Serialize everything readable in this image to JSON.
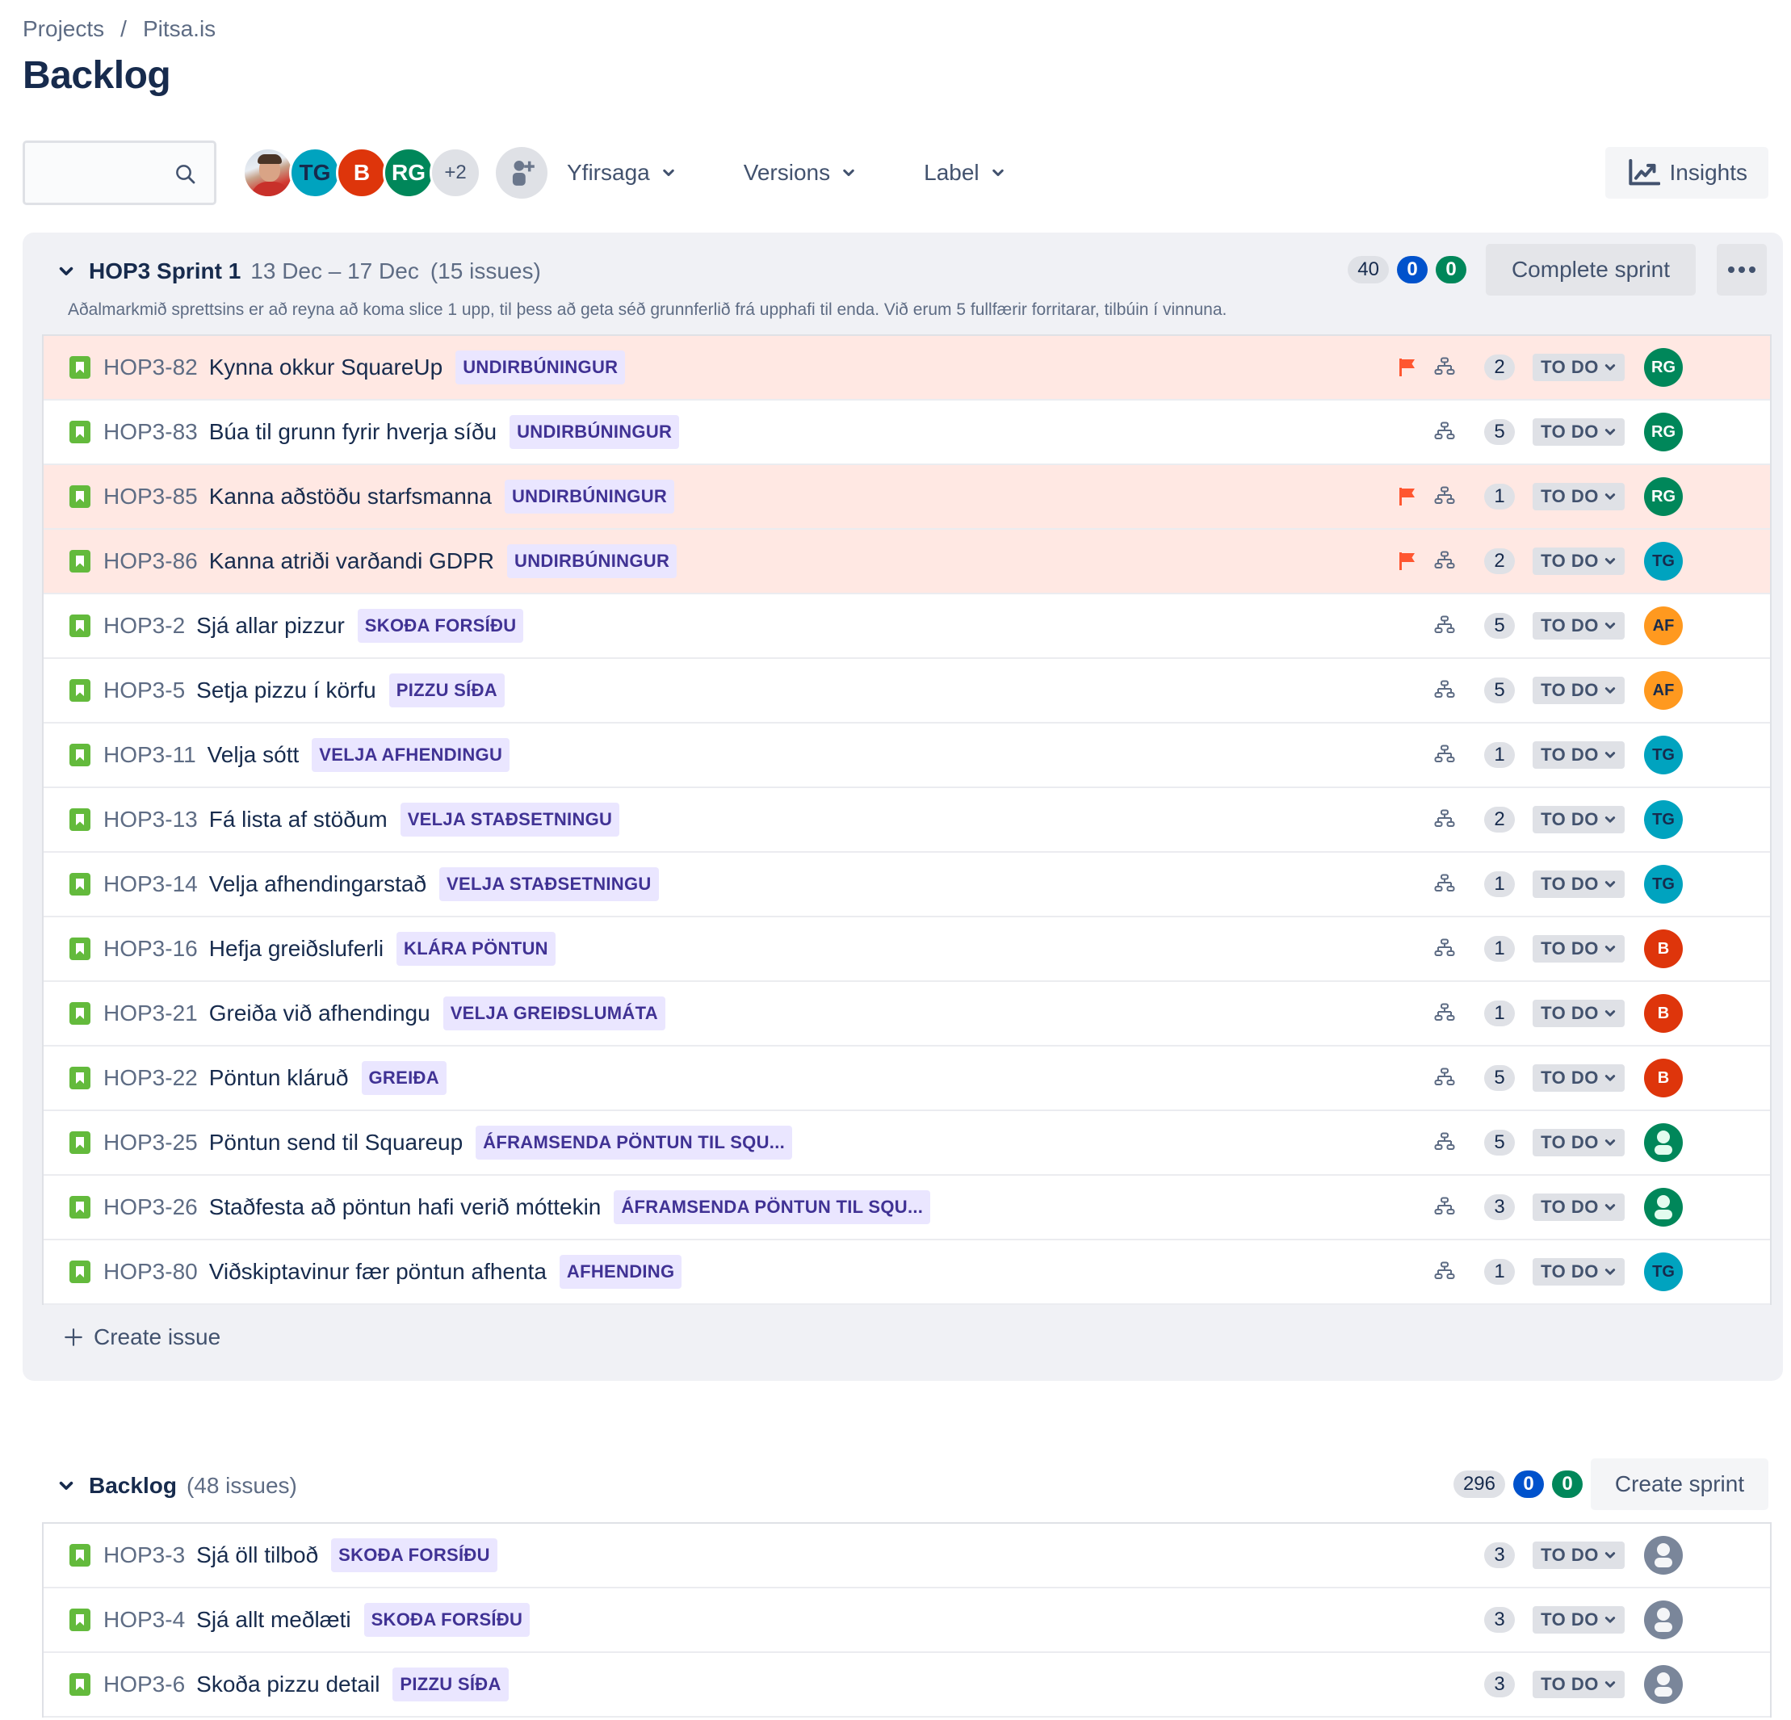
{
  "breadcrumb": {
    "items": [
      "Projects",
      "Pitsa.is"
    ],
    "separator": "/"
  },
  "page_title": "Backlog",
  "toolbar": {
    "search": {
      "value": "",
      "placeholder": ""
    },
    "avatars": [
      {
        "type": "photo",
        "initials": ""
      },
      {
        "initials": "TG",
        "color": "#00a3bf",
        "text_color": "#172b4d"
      },
      {
        "initials": "B",
        "color": "#de350b",
        "text_color": "#ffffff"
      },
      {
        "initials": "RG",
        "color": "#00875a",
        "text_color": "#ffffff"
      },
      {
        "initials": "+2",
        "color": "#dfe1e6",
        "text_color": "#42526e"
      }
    ],
    "filters": [
      "Yfirsaga",
      "Versions",
      "Label"
    ],
    "insights_label": "Insights"
  },
  "sprint": {
    "name": "HOP3 Sprint 1",
    "dates": "13 Dec – 17 Dec",
    "issue_count": "(15 issues)",
    "goal": "Aðalmarkmið sprettsins er að reyna að koma slice 1 upp, til þess að geta séð grunnferlið frá upphafi til enda. Við erum 5 fullfærir forritarar, tilbúin í vinnuna.",
    "points_total": "40",
    "points_in_progress": "0",
    "points_done": "0",
    "complete_label": "Complete sprint",
    "more_label": "•••",
    "create_issue_label": "Create issue",
    "issues": [
      {
        "key": "HOP3-82",
        "summary": "Kynna okkur SquareUp",
        "epic": "UNDIRBÚNINGUR",
        "flagged": true,
        "points": "2",
        "status": "TO DO",
        "assignee": "RG",
        "assignee_color": "#00875a",
        "assignee_text": "#ffffff"
      },
      {
        "key": "HOP3-83",
        "summary": "Búa til grunn fyrir hverja síðu",
        "epic": "UNDIRBÚNINGUR",
        "flagged": false,
        "points": "5",
        "status": "TO DO",
        "assignee": "RG",
        "assignee_color": "#00875a",
        "assignee_text": "#ffffff"
      },
      {
        "key": "HOP3-85",
        "summary": "Kanna aðstöðu starfsmanna",
        "epic": "UNDIRBÚNINGUR",
        "flagged": true,
        "points": "1",
        "status": "TO DO",
        "assignee": "RG",
        "assignee_color": "#00875a",
        "assignee_text": "#ffffff"
      },
      {
        "key": "HOP3-86",
        "summary": "Kanna atriði varðandi GDPR",
        "epic": "UNDIRBÚNINGUR",
        "flagged": true,
        "points": "2",
        "status": "TO DO",
        "assignee": "TG",
        "assignee_color": "#00a3bf",
        "assignee_text": "#172b4d"
      },
      {
        "key": "HOP3-2",
        "summary": "Sjá allar pizzur",
        "epic": "SKOÐA FORSÍÐU",
        "flagged": false,
        "points": "5",
        "status": "TO DO",
        "assignee": "AF",
        "assignee_color": "#ff991f",
        "assignee_text": "#172b4d"
      },
      {
        "key": "HOP3-5",
        "summary": "Setja pizzu í körfu",
        "epic": "PIZZU SÍÐA",
        "flagged": false,
        "points": "5",
        "status": "TO DO",
        "assignee": "AF",
        "assignee_color": "#ff991f",
        "assignee_text": "#172b4d"
      },
      {
        "key": "HOP3-11",
        "summary": "Velja sótt",
        "epic": "VELJA AFHENDINGU",
        "flagged": false,
        "points": "1",
        "status": "TO DO",
        "assignee": "TG",
        "assignee_color": "#00a3bf",
        "assignee_text": "#172b4d"
      },
      {
        "key": "HOP3-13",
        "summary": "Fá lista af stöðum",
        "epic": "VELJA STAÐSETNINGU",
        "flagged": false,
        "points": "2",
        "status": "TO DO",
        "assignee": "TG",
        "assignee_color": "#00a3bf",
        "assignee_text": "#172b4d"
      },
      {
        "key": "HOP3-14",
        "summary": "Velja afhendingarstað",
        "epic": "VELJA STAÐSETNINGU",
        "flagged": false,
        "points": "1",
        "status": "TO DO",
        "assignee": "TG",
        "assignee_color": "#00a3bf",
        "assignee_text": "#172b4d"
      },
      {
        "key": "HOP3-16",
        "summary": "Hefja greiðsluferli",
        "epic": "KLÁRA PÖNTUN",
        "flagged": false,
        "points": "1",
        "status": "TO DO",
        "assignee": "B",
        "assignee_color": "#de350b",
        "assignee_text": "#ffffff"
      },
      {
        "key": "HOP3-21",
        "summary": "Greiða við afhendingu",
        "epic": "VELJA GREIÐSLUMÁTA",
        "flagged": false,
        "points": "1",
        "status": "TO DO",
        "assignee": "B",
        "assignee_color": "#de350b",
        "assignee_text": "#ffffff"
      },
      {
        "key": "HOP3-22",
        "summary": "Pöntun kláruð",
        "epic": "GREIÐA",
        "flagged": false,
        "points": "5",
        "status": "TO DO",
        "assignee": "B",
        "assignee_color": "#de350b",
        "assignee_text": "#ffffff"
      },
      {
        "key": "HOP3-25",
        "summary": "Pöntun send til Squareup",
        "epic": "ÁFRAMSENDA PÖNTUN TIL SQU...",
        "flagged": false,
        "points": "5",
        "status": "TO DO",
        "assignee": "",
        "assignee_icon": "person-icon",
        "assignee_color": "#00875a",
        "assignee_text": "#ffffff"
      },
      {
        "key": "HOP3-26",
        "summary": "Staðfesta að pöntun hafi verið móttekin",
        "epic": "ÁFRAMSENDA PÖNTUN TIL SQU...",
        "flagged": false,
        "points": "3",
        "status": "TO DO",
        "assignee": "",
        "assignee_icon": "person-icon",
        "assignee_color": "#00875a",
        "assignee_text": "#ffffff"
      },
      {
        "key": "HOP3-80",
        "summary": "Viðskiptavinur fær pöntun afhenta",
        "epic": "AFHENDING",
        "flagged": false,
        "points": "1",
        "status": "TO DO",
        "assignee": "TG",
        "assignee_color": "#00a3bf",
        "assignee_text": "#172b4d"
      }
    ]
  },
  "backlog": {
    "name": "Backlog",
    "issue_count": "(48 issues)",
    "points_total": "296",
    "points_in_progress": "0",
    "points_done": "0",
    "create_sprint_label": "Create sprint",
    "issues": [
      {
        "key": "HOP3-3",
        "summary": "Sjá öll tilboð",
        "epic": "SKOÐA FORSÍÐU",
        "points": "3",
        "status": "TO DO",
        "assignee": "Unassigned"
      },
      {
        "key": "HOP3-4",
        "summary": "Sjá allt meðlæti",
        "epic": "SKOÐA FORSÍÐU",
        "points": "3",
        "status": "TO DO",
        "assignee": "Unassigned"
      },
      {
        "key": "HOP3-6",
        "summary": "Skoða pizzu detail",
        "epic": "PIZZU SÍÐA",
        "points": "3",
        "status": "TO DO",
        "assignee": "Unassigned"
      }
    ]
  },
  "colors": {
    "story_icon": "#63ba3c",
    "flag": "#ff5630",
    "flagged_row": "#ffe8e3",
    "epic_bg": "#eae6ff",
    "epic_text": "#403294",
    "in_progress": "#0052cc",
    "done": "#00875a"
  }
}
